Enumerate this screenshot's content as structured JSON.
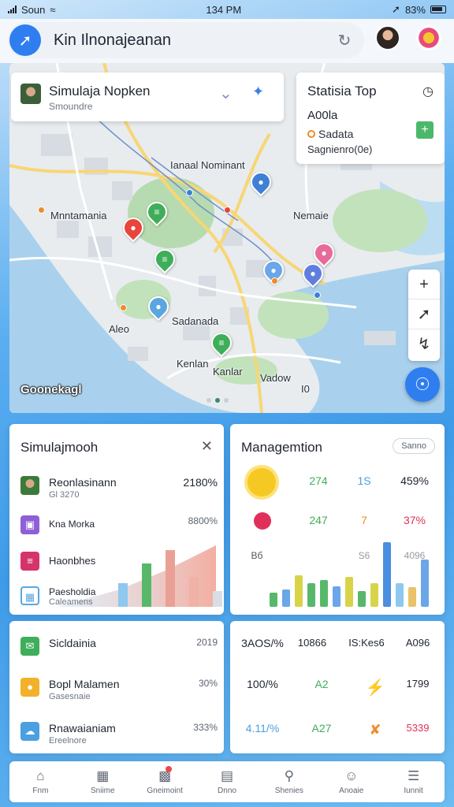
{
  "status": {
    "carrier": "Soun",
    "time": "134 PM",
    "battery": "83%"
  },
  "header": {
    "title": "Kin Ilnonajeanan"
  },
  "map": {
    "card": {
      "name": "Simulaja Nopken",
      "sub": "Smoundre"
    },
    "stats": {
      "title": "Statisia Top",
      "value": "A00la",
      "row_label": "Sadata",
      "sub": "Sagnienro(0e)"
    },
    "labels": [
      "Ianaal Nominant",
      "Mnntamania",
      "Nemaie",
      "Sadanada",
      "Aleo",
      "Kenlan",
      "Kanlar",
      "Vadow",
      "I0"
    ],
    "name": "Goonekagl"
  },
  "sim_card": {
    "title": "Simulajmooh",
    "rows": [
      {
        "name": "Reonlasinann",
        "sub": "Gl 3270",
        "value": "2180%"
      },
      {
        "name": "Kna Morka",
        "sub": "",
        "value": "8800%"
      },
      {
        "name": "Haonbhes",
        "sub": "",
        "value": ""
      },
      {
        "name": "Paesholdia",
        "sub": "Caleamens",
        "value": ""
      }
    ],
    "chart_values": [
      30,
      55,
      72,
      38,
      20
    ]
  },
  "mgmt_card": {
    "title": "Managemtion",
    "button": "Sanno",
    "row1": [
      "274",
      "1S",
      "459%"
    ],
    "row2": [
      "247",
      "7",
      "37%"
    ],
    "row3": [
      "Bб",
      "S6",
      "4096"
    ],
    "bar_values": [
      18,
      22,
      40,
      30,
      34,
      26,
      38,
      20,
      30,
      82,
      30,
      25,
      60
    ]
  },
  "list_card": {
    "rows": [
      {
        "name": "Sicldainia",
        "sub": "",
        "value": "2019"
      },
      {
        "name": "Bopl Malamen",
        "sub": "Gasesnaie",
        "value": "30%"
      },
      {
        "name": "Rnawaianiam",
        "sub": "Ereelnore",
        "value": "333%"
      }
    ]
  },
  "kpi_card": {
    "row1": [
      "3AOS/%",
      "10866",
      "IS:Kes6",
      "A096"
    ],
    "row2": [
      "100/%",
      "A2",
      "",
      "1799"
    ],
    "row3": [
      "4.11/%",
      "A27",
      "",
      "5339"
    ]
  },
  "nav": [
    {
      "label": "Fnm"
    },
    {
      "label": "Sniime"
    },
    {
      "label": "Gneimoint"
    },
    {
      "label": "Dnno"
    },
    {
      "label": "Shenies"
    },
    {
      "label": "Anoaie"
    },
    {
      "label": "Iunnit"
    }
  ]
}
